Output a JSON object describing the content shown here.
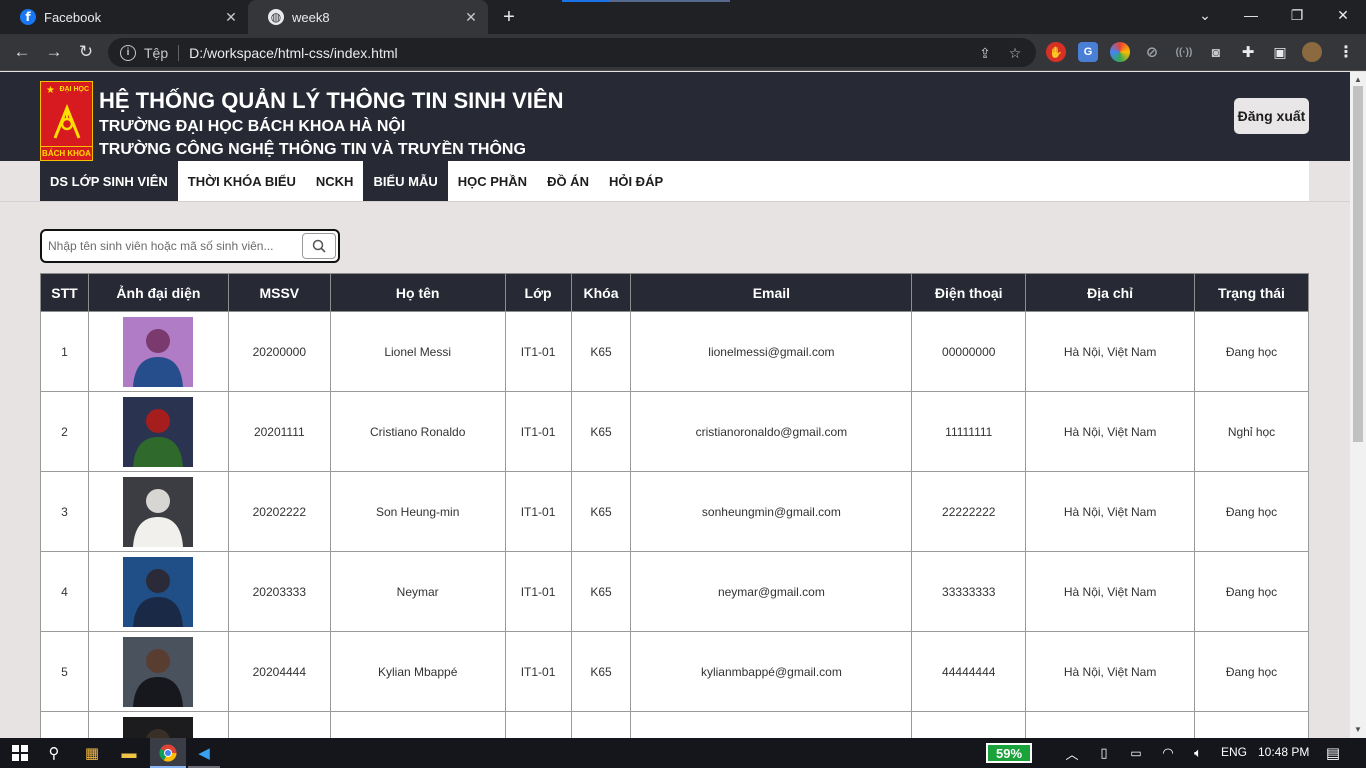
{
  "browser": {
    "tabs": [
      {
        "title": "Facebook",
        "active": false
      },
      {
        "title": "week8",
        "active": true
      }
    ],
    "address": {
      "scheme_label": "Tệp",
      "url": "D:/workspace/html-css/index.html"
    }
  },
  "header": {
    "logo": {
      "top_text": "ĐẠI HỌC",
      "bottom_text": "BÁCH KHOA"
    },
    "title": "HỆ THỐNG QUẢN LÝ THÔNG TIN SINH VIÊN",
    "subtitle1": "TRƯỜNG ĐẠI HỌC BÁCH KHOA HÀ NỘI",
    "subtitle2": "TRƯỜNG CÔNG NGHỆ THÔNG TIN VÀ TRUYỀN THÔNG",
    "logout_label": "Đăng xuất"
  },
  "menu": [
    {
      "label": "DS LỚP SINH VIÊN",
      "active": true
    },
    {
      "label": "THỜI KHÓA BIỂU",
      "active": false
    },
    {
      "label": "NCKH",
      "active": false
    },
    {
      "label": "BIỂU MẪU",
      "active": true
    },
    {
      "label": "HỌC PHẦN",
      "active": false
    },
    {
      "label": "ĐỒ ÁN",
      "active": false
    },
    {
      "label": "HỎI ĐÁP",
      "active": false
    }
  ],
  "search": {
    "placeholder": "Nhập tên sinh viên hoặc mã số sinh viên..."
  },
  "table": {
    "columns": [
      "STT",
      "Ảnh đại diện",
      "MSSV",
      "Họ tên",
      "Lớp",
      "Khóa",
      "Email",
      "Điện thoại",
      "Địa chỉ",
      "Trạng thái"
    ],
    "rows": [
      {
        "stt": "1",
        "mssv": "20200000",
        "name": "Lionel Messi",
        "class": "IT1-01",
        "cohort": "K65",
        "email": "lionelmessi@gmail.com",
        "phone": "00000000",
        "address": "Hà Nội, Việt Nam",
        "status": "Đang học",
        "photo_colors": [
          "#b07cc6",
          "#7a3a6e",
          "#274e8c"
        ]
      },
      {
        "stt": "2",
        "mssv": "20201111",
        "name": "Cristiano Ronaldo",
        "class": "IT1-01",
        "cohort": "K65",
        "email": "cristianoronaldo@gmail.com",
        "phone": "11111111",
        "address": "Hà Nội, Việt Nam",
        "status": "Nghỉ học",
        "photo_colors": [
          "#2a3350",
          "#a51d1d",
          "#2f6a2c"
        ]
      },
      {
        "stt": "3",
        "mssv": "20202222",
        "name": "Son Heung-min",
        "class": "IT1-01",
        "cohort": "K65",
        "email": "sonheungmin@gmail.com",
        "phone": "22222222",
        "address": "Hà Nội, Việt Nam",
        "status": "Đang học",
        "photo_colors": [
          "#3b3d42",
          "#d8d6d2",
          "#f1f0ec"
        ]
      },
      {
        "stt": "4",
        "mssv": "20203333",
        "name": "Neymar",
        "class": "IT1-01",
        "cohort": "K65",
        "email": "neymar@gmail.com",
        "phone": "33333333",
        "address": "Hà Nội, Việt Nam",
        "status": "Đang học",
        "photo_colors": [
          "#1f4f86",
          "#2b2a39",
          "#1a2a46"
        ]
      },
      {
        "stt": "5",
        "mssv": "20204444",
        "name": "Kylian Mbappé",
        "class": "IT1-01",
        "cohort": "K65",
        "email": "kylianmbappé@gmail.com",
        "phone": "44444444",
        "address": "Hà Nội, Việt Nam",
        "status": "Đang học",
        "photo_colors": [
          "#4a525d",
          "#5a3d31",
          "#16181d"
        ]
      },
      {
        "stt": "",
        "mssv": "",
        "name": "",
        "class": "",
        "cohort": "",
        "email": "",
        "phone": "",
        "address": "",
        "status": "",
        "photo_colors": [
          "#1c1c1e",
          "#3a2f26",
          "#1c1c1e"
        ]
      }
    ]
  },
  "taskbar": {
    "battery": "59%",
    "language": "ENG",
    "time": "10:48 PM"
  }
}
